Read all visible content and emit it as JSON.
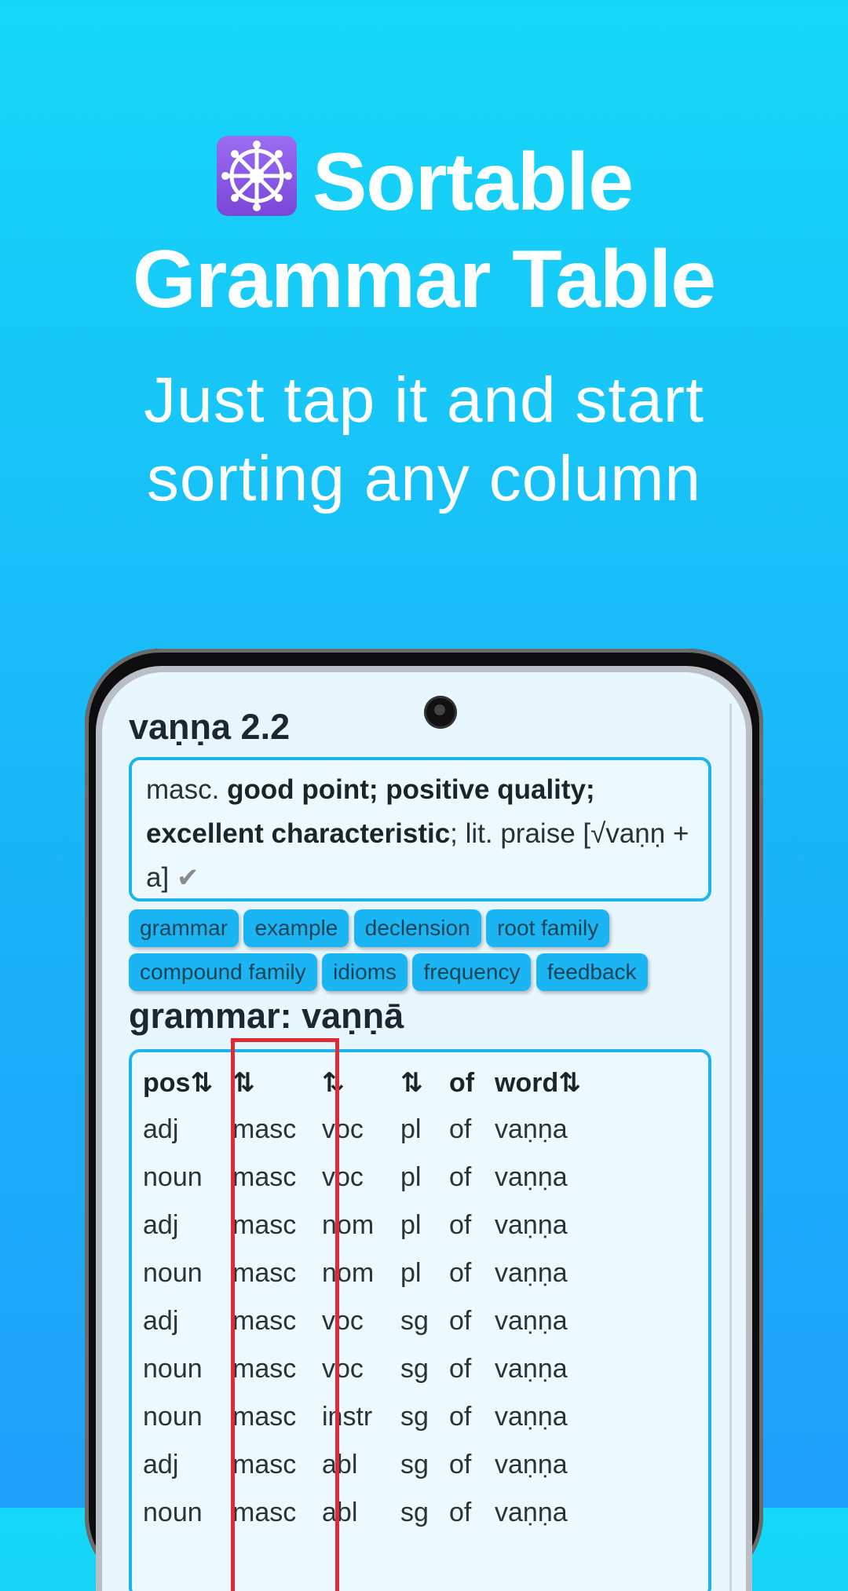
{
  "hero": {
    "title_line1": "Sortable",
    "title_line2": "Grammar Table",
    "subtitle_line1": "Just tap it and start",
    "subtitle_line2": "sorting any column",
    "icon": "dharma-wheel-icon"
  },
  "entry": {
    "headword": "vaṇṇa 2.2",
    "definition": {
      "pos": "masc.",
      "meaning_bold1": "good point; positive quality;",
      "meaning_bold2": "excellent characteristic",
      "rest": "; lit. praise [√vaṇṇ + a]",
      "check": "✔"
    },
    "buttons": [
      "grammar",
      "example",
      "declension",
      "root family",
      "compound family",
      "idioms",
      "frequency",
      "feedback"
    ]
  },
  "grammar": {
    "heading": "grammar: vaṇṇā",
    "headers": [
      "pos⇅",
      "⇅",
      "⇅",
      "⇅",
      "of",
      "word⇅"
    ],
    "rows": [
      [
        "adj",
        "masc",
        "voc",
        "pl",
        "of",
        "vaṇṇa"
      ],
      [
        "noun",
        "masc",
        "voc",
        "pl",
        "of",
        "vaṇṇa"
      ],
      [
        "adj",
        "masc",
        "nom",
        "pl",
        "of",
        "vaṇṇa"
      ],
      [
        "noun",
        "masc",
        "nom",
        "pl",
        "of",
        "vaṇṇa"
      ],
      [
        "adj",
        "masc",
        "voc",
        "sg",
        "of",
        "vaṇṇa"
      ],
      [
        "noun",
        "masc",
        "voc",
        "sg",
        "of",
        "vaṇṇa"
      ],
      [
        "noun",
        "masc",
        "instr",
        "sg",
        "of",
        "vaṇṇa"
      ],
      [
        "adj",
        "masc",
        "abl",
        "sg",
        "of",
        "vaṇṇa"
      ],
      [
        "noun",
        "masc",
        "abl",
        "sg",
        "of",
        "vaṇṇa"
      ]
    ]
  },
  "colors": {
    "accent": "#1fb2ec",
    "highlight": "#e12b34",
    "button_bg": "#1ab5f2"
  }
}
